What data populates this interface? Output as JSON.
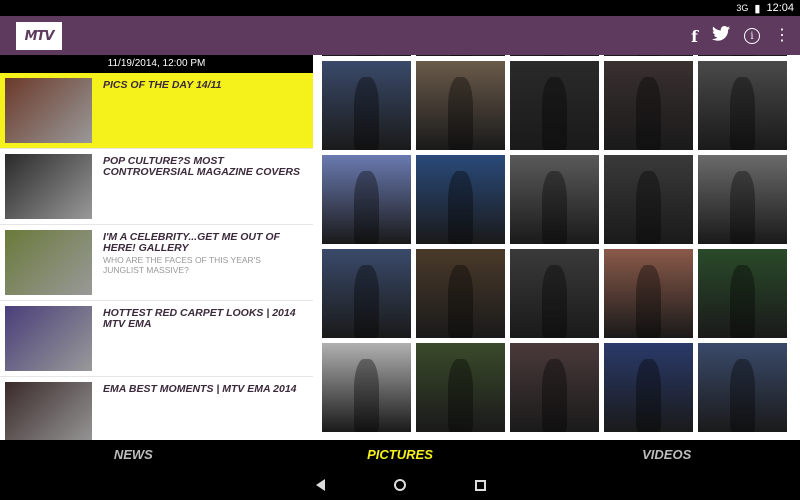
{
  "status": {
    "signal": "3G",
    "time": "12:04"
  },
  "app": {
    "logo_text": "MTV"
  },
  "header_icons": [
    "facebook-icon",
    "twitter-icon",
    "info-icon",
    "overflow-menu-icon"
  ],
  "news": {
    "date": "11/19/2014, 12:00 PM",
    "items": [
      {
        "title": "PICS OF THE DAY 14/11",
        "sub": "",
        "thumb_color": "#6b3a2a"
      },
      {
        "title": "POP CULTURE?S MOST CONTROVERSIAL MAGAZINE COVERS",
        "sub": "",
        "thumb_color": "#2a2a2a"
      },
      {
        "title": "I'M A CELEBRITY...GET ME OUT OF HERE! GALLERY",
        "sub": "WHO ARE THE FACES OF THIS YEAR'S JUNGLIST MASSIVE?",
        "thumb_color": "#6a7a3a"
      },
      {
        "title": "HOTTEST RED CARPET LOOKS | 2014 MTV EMA",
        "sub": "",
        "thumb_color": "#4a3f7a"
      },
      {
        "title": "EMA BEST MOMENTS | MTV EMA 2014",
        "sub": "",
        "thumb_color": "#3a2a2a"
      }
    ]
  },
  "pictures": {
    "tiles": [
      "#7a5a4a",
      "#b8a090",
      "#3a3a3a",
      "#4a3a30",
      "#8a8a8a",
      "#3a4a6a",
      "#6a5a4a",
      "#2a2a2a",
      "#3a3030",
      "#4a4a4a",
      "#6a7ab0",
      "#2a4a7a",
      "#5a5a5a",
      "#3a3a3a",
      "#6a6a6a",
      "#3a4a6a",
      "#4a3a2a",
      "#3a3a3a",
      "#8a5a4a",
      "#2a4a2a",
      "#b0b0b0",
      "#3a4a2a",
      "#4a3a3a",
      "#2a3a6a",
      "#3a4a6a"
    ]
  },
  "tabs": {
    "news": "NEWS",
    "pictures": "PICTURES",
    "videos": "VIDEOS"
  }
}
